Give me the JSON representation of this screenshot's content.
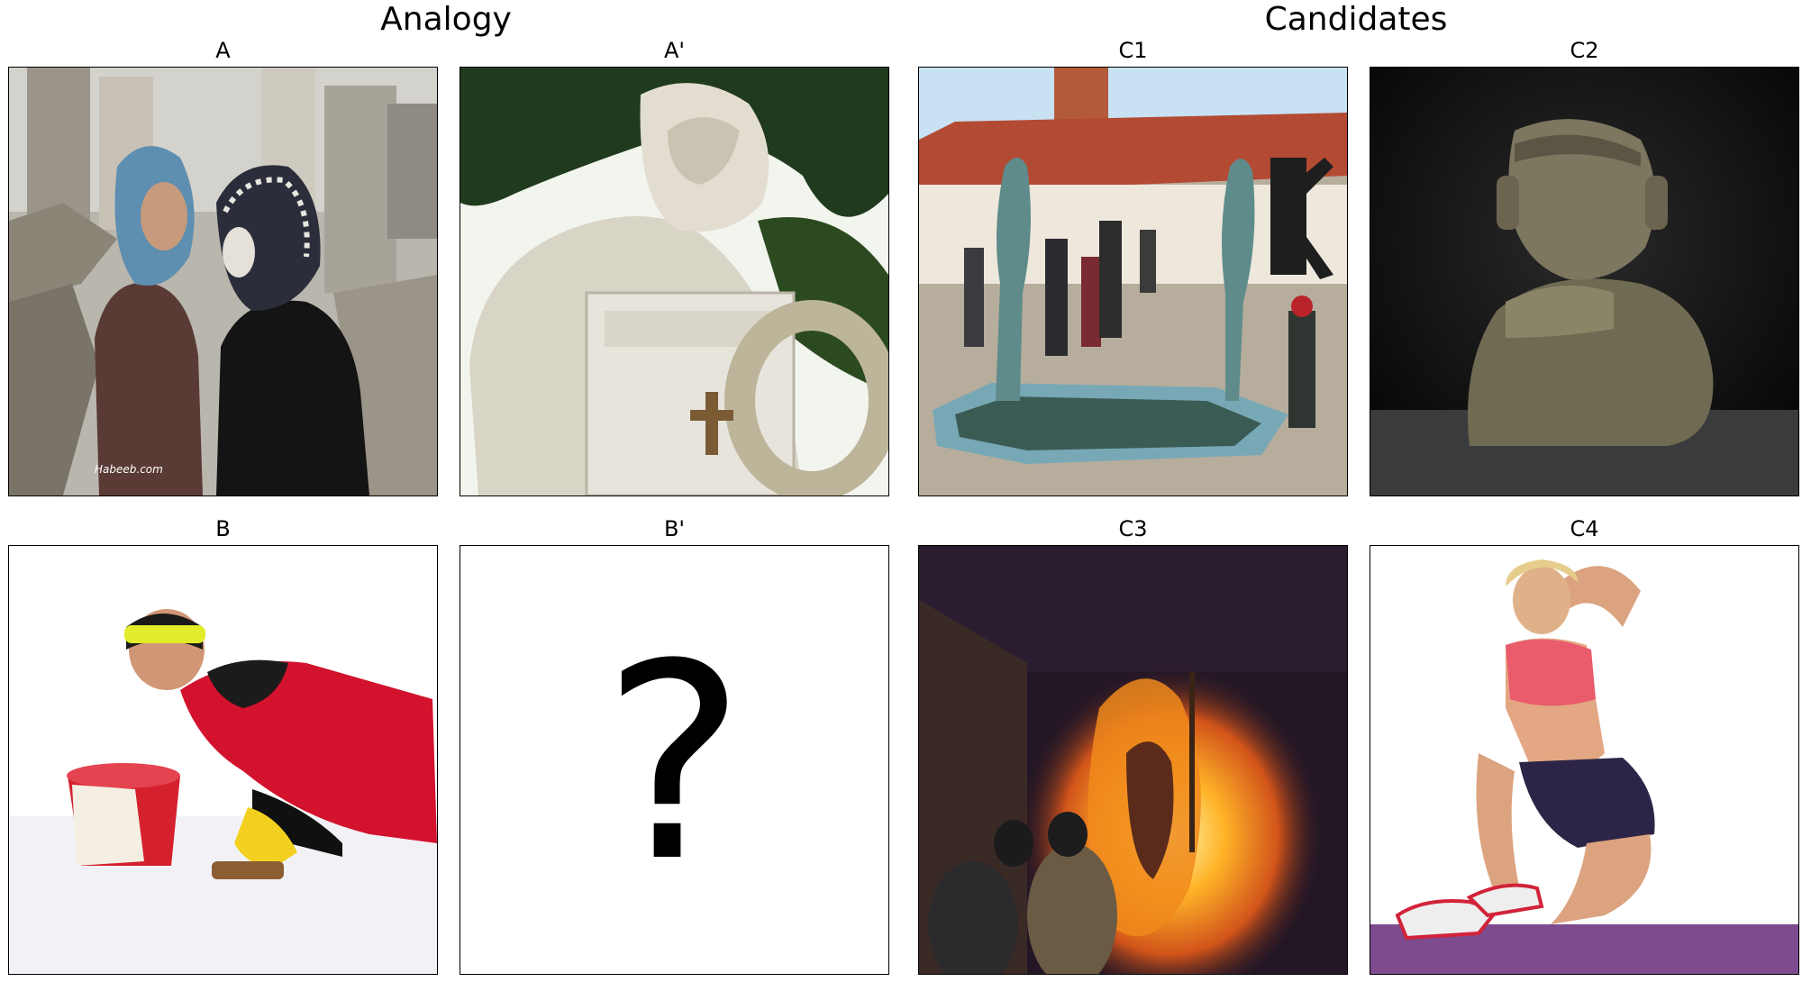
{
  "titles": {
    "analogy": "Analogy",
    "candidates": "Candidates"
  },
  "panels": [
    {
      "id": "A",
      "label": "A",
      "content": "photo"
    },
    {
      "id": "A2",
      "label": "A'",
      "content": "photo"
    },
    {
      "id": "C1",
      "label": "C1",
      "content": "photo"
    },
    {
      "id": "C2",
      "label": "C2",
      "content": "photo"
    },
    {
      "id": "B",
      "label": "B",
      "content": "photo"
    },
    {
      "id": "B2",
      "label": "B'",
      "content": "question-mark",
      "glyph": "?"
    },
    {
      "id": "C3",
      "label": "C3",
      "content": "photo"
    },
    {
      "id": "C4",
      "label": "C4",
      "content": "photo"
    }
  ],
  "watermark_A": "Habeeb.com"
}
